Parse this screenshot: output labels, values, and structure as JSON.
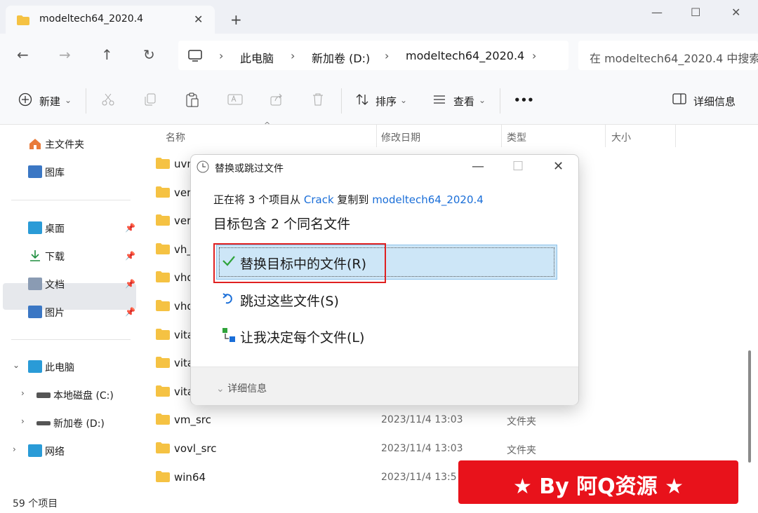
{
  "window": {
    "tab_title": "modeltech64_2020.4",
    "tab_close": "✕",
    "new_tab": "+",
    "min": "—",
    "max": "☐",
    "close": "✕"
  },
  "nav": {
    "back": "←",
    "forward": "→",
    "up": "↑",
    "refresh": "↻"
  },
  "address": {
    "crumbs": [
      "此电脑",
      "新加卷 (D:)",
      "modeltech64_2020.4"
    ],
    "sep": "›",
    "search_placeholder": "在 modeltech64_2020.4 中搜索"
  },
  "toolbar": {
    "new": "新建",
    "sort": "排序",
    "view": "查看",
    "more": "•••",
    "details": "详细信息",
    "caret": "⌄"
  },
  "sidebar": {
    "home": "主文件夹",
    "gallery": "图库",
    "desktop": "桌面",
    "downloads": "下载",
    "documents": "文档",
    "pictures": "图片",
    "this_pc": "此电脑",
    "local_disk": "本地磁盘 (C:)",
    "new_volume": "新加卷 (D:)",
    "network": "网络",
    "pin": "📌"
  },
  "columns": {
    "name": "名称",
    "modified": "修改日期",
    "type": "类型",
    "size": "大小"
  },
  "files": [
    {
      "name": "uvm",
      "date": "",
      "type": ""
    },
    {
      "name": "ver",
      "date": "",
      "type": ""
    },
    {
      "name": "ver",
      "date": "",
      "type": ""
    },
    {
      "name": "vh_",
      "date": "",
      "type": ""
    },
    {
      "name": "vhd",
      "date": "",
      "type": ""
    },
    {
      "name": "vhd",
      "date": "",
      "type": ""
    },
    {
      "name": "vita",
      "date": "",
      "type": ""
    },
    {
      "name": "vita",
      "date": "",
      "type": ""
    },
    {
      "name": "vita",
      "date": "",
      "type": ""
    },
    {
      "name": "vm_src",
      "date": "2023/11/4 13:03",
      "type": "文件夹"
    },
    {
      "name": "vovl_src",
      "date": "2023/11/4 13:03",
      "type": "文件夹"
    },
    {
      "name": "win64",
      "date": "2023/11/4 13:5",
      "type": ""
    }
  ],
  "status": "59 个项目",
  "dialog": {
    "title": "替换或跳过文件",
    "line1_pre": "正在将 3 个项目从 ",
    "line1_src": "Crack",
    "line1_mid": " 复制到 ",
    "line1_dst": "modeltech64_2020.4",
    "line2": "目标包含 2 个同名文件",
    "opt_replace": "替换目标中的文件(R)",
    "opt_skip": "跳过这些文件(S)",
    "opt_decide": "让我决定每个文件(L)",
    "details": "详细信息",
    "details_caret": "⌄"
  },
  "banner": "★ By 阿Q资源 ★"
}
